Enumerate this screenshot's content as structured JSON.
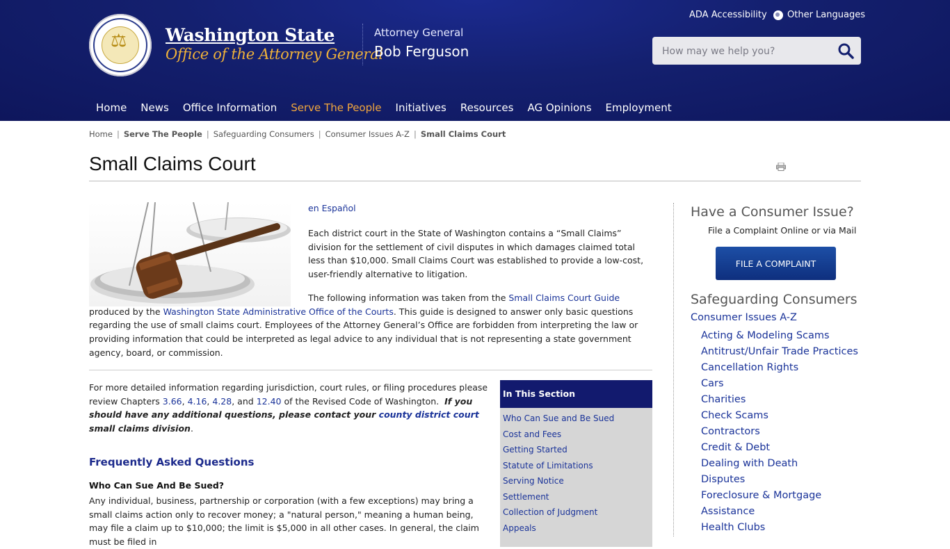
{
  "header": {
    "brand_title": "Washington State",
    "brand_subtitle": "Office of the Attorney General",
    "ag_label": "Attorney General",
    "ag_name": "Bob Ferguson",
    "ada_link": "ADA Accessibility",
    "languages_link": "Other Languages",
    "search_placeholder": "How may we help you?",
    "nav": [
      {
        "label": "Home"
      },
      {
        "label": "News"
      },
      {
        "label": "Office Information"
      },
      {
        "label": "Serve The People",
        "active": true
      },
      {
        "label": "Initiatives"
      },
      {
        "label": "Resources"
      },
      {
        "label": "AG Opinions"
      },
      {
        "label": "Employment"
      }
    ]
  },
  "breadcrumb": [
    "Home",
    "Serve The People",
    "Safeguarding Consumers",
    "Consumer Issues A-Z",
    "Small Claims Court"
  ],
  "page_title": "Small Claims Court",
  "content": {
    "en_espanol": "en Español",
    "para1": "Each district court in the State of Washington contains a “Small Claims” division for the settlement of civil disputes in which damages claimed total less than $10,000.  Small Claims Court was established to provide a low-cost, user-friendly alternative to litigation.",
    "para2_prefix": "The following information was taken from the ",
    "para2_link1": "Small Claims Court Guide",
    "para2_mid": " produced by the ",
    "para2_link2": "Washington State Administrative Office of the Courts",
    "para2_suffix": ". This guide is designed to answer only basic questions regarding the use of small claims court.  Employees of the Attorney General’s Office are forbidden from interpreting the law or providing information that could be interpreted as legal advice to any individual that is not representing a state government agency, board, or commission.",
    "para3_prefix": "For more detailed information regarding jurisdiction, court rules, or filing procedures please review Chapters ",
    "chapters": [
      "3.66",
      "4.16",
      "4.28",
      "12.40"
    ],
    "para3_and": "and",
    "para3_rcw": " of the Revised Code of Washington.",
    "para3_emph_prefix": "If you should have any additional questions, please contact your ",
    "para3_emph_link": "county district court",
    "para3_emph_suffix": " small claims division",
    "faq_title": "Frequently Asked Questions",
    "faq_q1": "Who Can Sue And Be Sued?",
    "faq_a1": "Any individual, business, partnership or corporation (with a few exceptions) may bring a small claims action only to recover money; a \"natural person,\" meaning a human being, may file a claim up to $10,000; the limit is $5,000 in all other cases. In general, the claim must be filed in"
  },
  "in_this_section": {
    "title": "In This Section",
    "items": [
      "Who Can Sue and Be Sued",
      "Cost and Fees",
      "Getting Started",
      "Statute of Limitations",
      "Serving Notice",
      "Settlement",
      "Collection of Judgment",
      "Appeals"
    ]
  },
  "sidebar": {
    "heading": "Have a Consumer Issue?",
    "subheading": "File a Complaint Online or via Mail",
    "button": "FILE A COMPLAINT",
    "section_heading": "Safeguarding Consumers",
    "top_link": "Consumer Issues A-Z",
    "links": [
      "Acting & Modeling Scams",
      "Antitrust/Unfair Trade Practices",
      "Cancellation Rights",
      "Cars",
      "Charities",
      "Check Scams",
      "Contractors",
      "Credit & Debt",
      "Dealing with Death",
      "Disputes",
      "Foreclosure & Mortgage",
      "Assistance",
      "Health Clubs"
    ]
  },
  "colors": {
    "header_bg": "#14206f",
    "nav_active": "#f2a73d",
    "brand_subtitle": "#f0b23a",
    "link": "#1a3399",
    "section_head_bg": "#121a6e"
  }
}
